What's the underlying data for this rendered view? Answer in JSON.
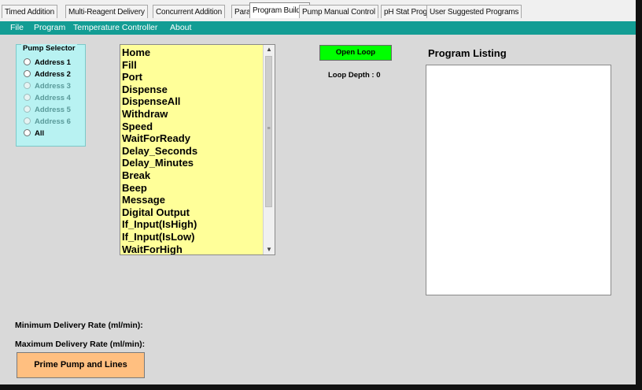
{
  "tabs": [
    {
      "label": "Timed Addition"
    },
    {
      "label": "Multi-Reagent Delivery"
    },
    {
      "label": "Concurrent Addition"
    },
    {
      "label": "Parallel Addition"
    },
    {
      "label": "Program Builder"
    },
    {
      "label": "Pump Manual Control"
    },
    {
      "label": "pH Stat Program"
    },
    {
      "label": "User Suggested Programs"
    }
  ],
  "active_tab": "Program Builder",
  "menu": [
    {
      "label": "File"
    },
    {
      "label": "Program"
    },
    {
      "label": "Temperature Controller"
    },
    {
      "label": "About"
    }
  ],
  "pump_selector": {
    "title": "Pump Selector",
    "options": [
      {
        "label": "Address 1",
        "enabled": true
      },
      {
        "label": "Address 2",
        "enabled": true
      },
      {
        "label": "Address 3",
        "enabled": false
      },
      {
        "label": "Address 4",
        "enabled": false
      },
      {
        "label": "Address 5",
        "enabled": false
      },
      {
        "label": "Address 6",
        "enabled": false
      },
      {
        "label": "All",
        "enabled": true
      }
    ]
  },
  "commands": [
    "Home",
    "Fill",
    "Port",
    "Dispense",
    "DispenseAll",
    "Withdraw",
    "Speed",
    "WaitForReady",
    "Delay_Seconds",
    "Delay_Minutes",
    "Break",
    "Beep",
    "Message",
    "Digital Output",
    "If_Input(IsHigh)",
    "If_Input(IsLow)",
    "WaitForHigh"
  ],
  "loop": {
    "button_label": "Open Loop",
    "depth_text": "Loop Depth : 0"
  },
  "program_listing": {
    "title": "Program Listing"
  },
  "rates": {
    "min_label": "Minimum Delivery Rate (ml/min):",
    "max_label": "Maximum Delivery Rate (ml/min):"
  },
  "prime_button_label": "Prime Pump and Lines",
  "colors": {
    "menubar": "#139d94",
    "pump_selector_bg": "#b8f2f2",
    "command_list_bg": "#ffff99",
    "open_loop_bg": "#00ff00",
    "prime_button_bg": "#ffbf80"
  }
}
